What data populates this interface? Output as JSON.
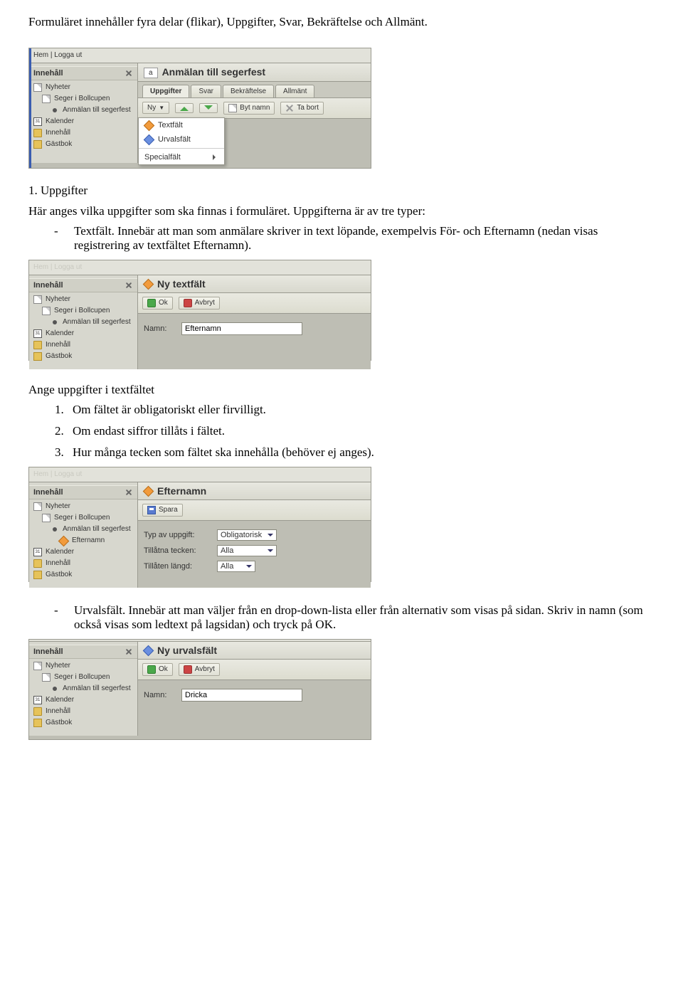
{
  "intro": "Formuläret innehåller fyra delar (flikar), Uppgifter, Svar, Bekräftelse och Allmänt.",
  "section1_title": "1. Uppgifter",
  "section1_body": "Här anges vilka uppgifter som ska finnas i formuläret. Uppgifterna är av tre typer:",
  "typer": {
    "textfalt": "Textfält. Innebär att man som anmälare skriver in text löpande, exempelvis För- och Efternamn (nedan visas registrering av textfältet Efternamn)."
  },
  "ange_title": "Ange uppgifter i textfältet",
  "ange_items": {
    "1": "Om fältet är obligatoriskt eller firvilligt.",
    "2": "Om endast siffror tillåts i fältet.",
    "3": "Hur många tecken som fältet ska innehålla (behöver ej anges)."
  },
  "urvalsfalt": "Urvalsfält. Innebär att man väljer från en drop-down-lista eller från alternativ som visas på sidan. Skriv in namn (som också visas som ledtext på lagsidan) och tryck på OK.",
  "topnav": {
    "hem": "Hem",
    "loggaut": "Logga ut"
  },
  "sidebar": {
    "header": "Innehåll",
    "items": {
      "nyheter": "Nyheter",
      "seger": "Seger i Bollcupen",
      "anmalan": "Anmälan till segerfest",
      "efternamn": "Efternamn",
      "kalender": "Kalender",
      "innehall": "Innehåll",
      "gastbok": "Gästbok"
    }
  },
  "screens": {
    "s1": {
      "chip": "a",
      "title": "Anmälan till segerfest",
      "tabs": {
        "uppgifter": "Uppgifter",
        "svar": "Svar",
        "bekraftelse": "Bekräftelse",
        "allmant": "Allmänt"
      },
      "toolbar": {
        "ny": "Ny",
        "bytnamn": "Byt namn",
        "tabort": "Ta bort"
      },
      "menu": {
        "textfalt": "Textfält",
        "urvalsfalt": "Urvalsfält",
        "specialfalt": "Specialfält"
      }
    },
    "s2": {
      "title": "Ny textfält",
      "toolbar": {
        "ok": "Ok",
        "avbryt": "Avbryt"
      },
      "namn_label": "Namn:",
      "namn_value": "Efternamn"
    },
    "s3": {
      "title": "Efternamn",
      "toolbar": {
        "spara": "Spara"
      },
      "rows": {
        "typ_label": "Typ av uppgift:",
        "typ_value": "Obligatorisk",
        "tecken_label": "Tillåtna tecken:",
        "tecken_value": "Alla",
        "langd_label": "Tillåten längd:",
        "langd_value": "Alla"
      }
    },
    "s4": {
      "title": "Ny urvalsfält",
      "toolbar": {
        "ok": "Ok",
        "avbryt": "Avbryt"
      },
      "namn_label": "Namn:",
      "namn_value": "Dricka"
    }
  }
}
